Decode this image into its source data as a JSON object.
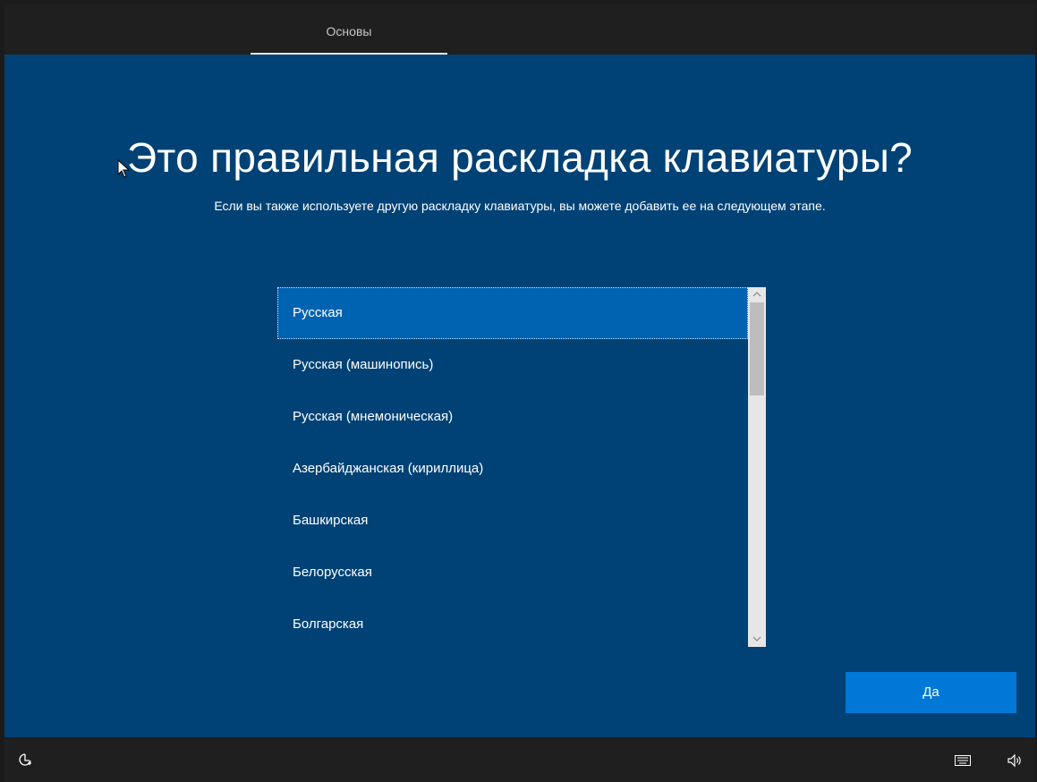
{
  "header": {
    "tabs": [
      {
        "label": "Основы",
        "active": true
      }
    ]
  },
  "main": {
    "title": "Это правильная раскладка клавиатуры?",
    "subtitle": "Если вы также используете другую раскладку клавиатуры, вы можете добавить ее на следующем этапе.",
    "layouts": [
      {
        "label": "Русская",
        "selected": true
      },
      {
        "label": "Русская (машинопись)"
      },
      {
        "label": "Русская (мнемоническая)"
      },
      {
        "label": "Азербайджанская (кириллица)"
      },
      {
        "label": "Башкирская"
      },
      {
        "label": "Белорусская"
      },
      {
        "label": "Болгарская"
      }
    ],
    "confirm_button": "Да"
  },
  "footer": {
    "icons": [
      "accessibility-icon",
      "keyboard-icon",
      "volume-icon"
    ]
  },
  "colors": {
    "background": "#004275",
    "selected_item": "#0063b1",
    "button": "#0078d7",
    "chrome": "#1f1f1f"
  }
}
